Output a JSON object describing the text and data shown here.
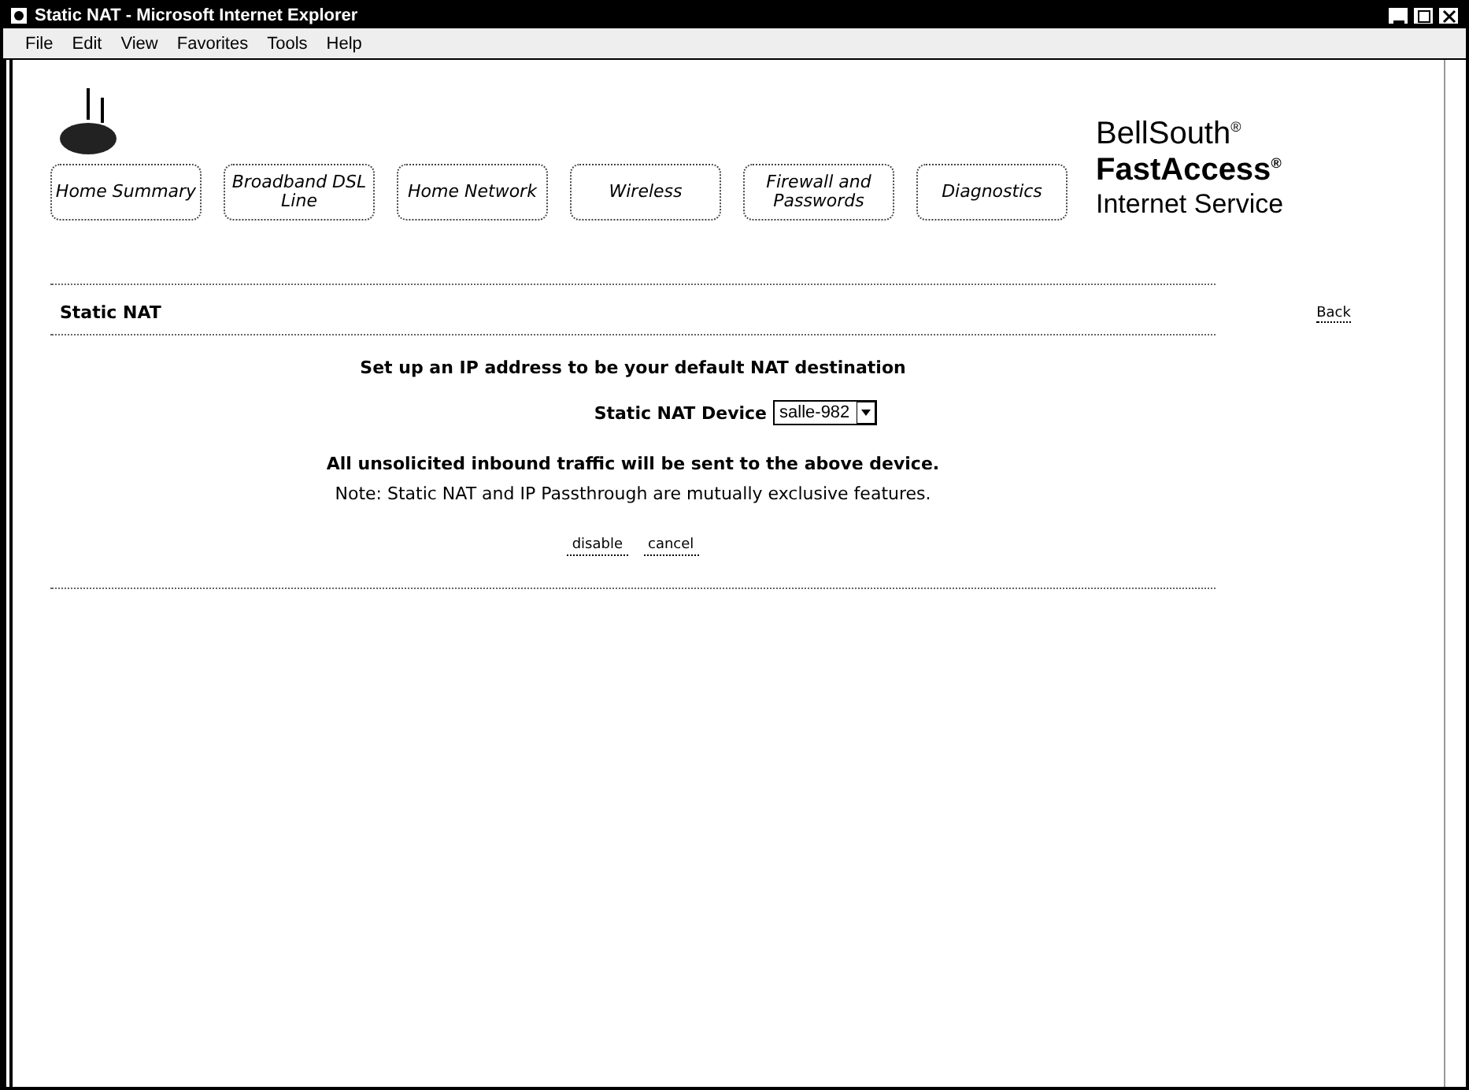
{
  "window": {
    "title": "Static NAT - Microsoft Internet Explorer"
  },
  "menu": [
    "File",
    "Edit",
    "View",
    "Favorites",
    "Tools",
    "Help"
  ],
  "nav": [
    {
      "label": "Home Summary"
    },
    {
      "label": "Broadband DSL Line"
    },
    {
      "label": "Home Network"
    },
    {
      "label": "Wireless"
    },
    {
      "label": "Firewall and Passwords"
    },
    {
      "label": "Diagnostics"
    }
  ],
  "brand": [
    "BellSouth$^{®}$",
    "FastAccess$^{®}$",
    "Internet Service"
  ],
  "section": {
    "title": "Static NAT",
    "back": "Back"
  },
  "intro": "Set up an IP address to be your default NAT destination",
  "device": {
    "label": "Static NAT Device",
    "value": "salle-982"
  },
  "notes": [
    "All unsolicited inbound traffic will be sent to the above device.",
    "Note: Static NAT and IP Passthrough are mutually exclusive features."
  ],
  "buttons": [
    "disable",
    "cancel"
  ]
}
